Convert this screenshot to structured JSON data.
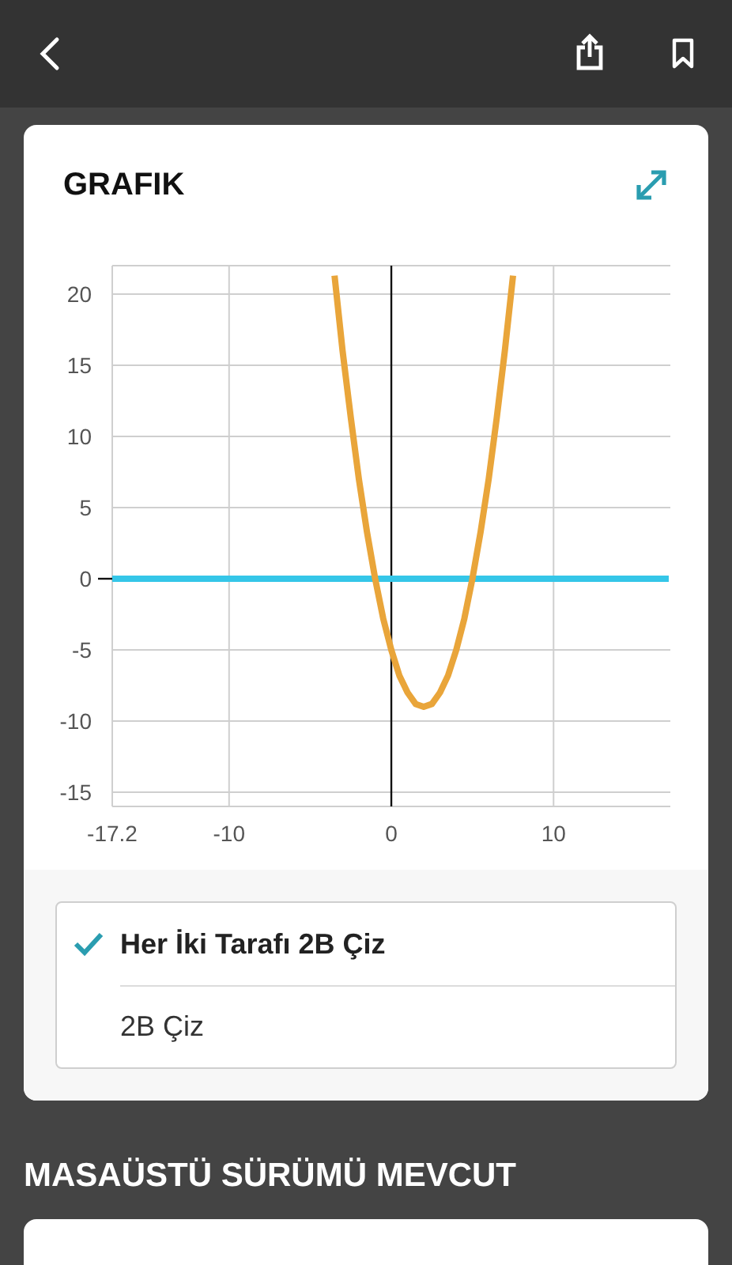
{
  "graph_card": {
    "title": "GRAFIK",
    "chart_data": {
      "type": "line",
      "grid": true,
      "x": [
        -17.2,
        -3.5,
        -3,
        -2.5,
        -2,
        -1.5,
        -1,
        -0.5,
        0,
        0.5,
        1,
        1.5,
        2,
        2.5,
        3,
        3.5,
        4,
        4.5,
        5,
        5.5,
        6,
        6.5,
        7,
        7.5,
        17.1
      ],
      "series": [
        {
          "color": "#e9a53a",
          "values": [
            null,
            21.3,
            16,
            11.3,
            7,
            3.3,
            0,
            -2.8,
            -5,
            -6.8,
            -8,
            -8.8,
            -9,
            -8.8,
            -8,
            -6.8,
            -5,
            -2.8,
            0,
            3.3,
            7,
            11.3,
            16,
            21.3,
            null
          ]
        },
        {
          "color": "#35c6e8",
          "values": [
            0,
            0,
            0,
            0,
            0,
            0,
            0,
            0,
            0,
            0,
            0,
            0,
            0,
            0,
            0,
            0,
            0,
            0,
            0,
            0,
            0,
            0,
            0,
            0,
            0
          ]
        }
      ],
      "xlim": [
        -17.2,
        17.1
      ],
      "ylim": [
        -16,
        22
      ],
      "xticks": [
        -17.2,
        -10,
        0,
        10
      ],
      "yticks": [
        -15,
        -10,
        -5,
        0,
        5,
        10,
        15,
        20
      ]
    },
    "options": [
      {
        "label": "Her İki Tarafı 2B Çiz",
        "selected": true
      },
      {
        "label": "2B Çiz",
        "selected": false
      }
    ]
  },
  "section_heading": "MASAÜSTÜ SÜRÜMÜ MEVCUT"
}
